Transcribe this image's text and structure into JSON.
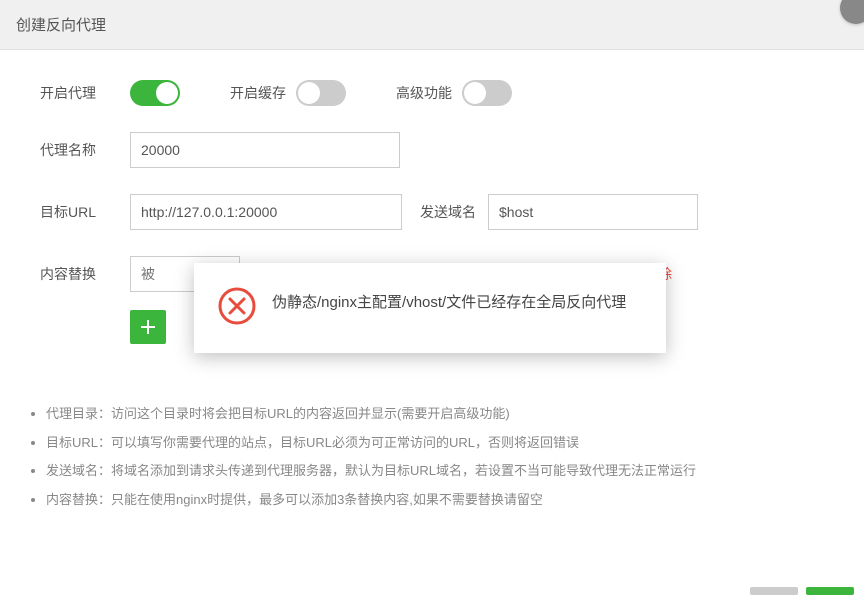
{
  "header": {
    "title": "创建反向代理"
  },
  "form": {
    "proxy_label": "开启代理",
    "cache_label": "开启缓存",
    "advanced_label": "高级功能",
    "name_label": "代理名称",
    "name_value": "20000",
    "url_label": "目标URL",
    "url_value": "http://127.0.0.1:20000",
    "send_domain_label": "发送域名",
    "send_domain_value": "$host",
    "replace_label": "内容替换",
    "replace_from_placeholder": "被",
    "delete_label": "删除"
  },
  "notes": {
    "n1": "代理目录：访问这个目录时将会把目标URL的内容返回并显示(需要开启高级功能)",
    "n2": "目标URL：可以填写你需要代理的站点，目标URL必须为可正常访问的URL，否则将返回错误",
    "n3": "发送域名：将域名添加到请求头传递到代理服务器，默认为目标URL域名，若设置不当可能导致代理无法正常运行",
    "n4": "内容替换：只能在使用nginx时提供，最多可以添加3条替换内容,如果不需要替换请留空"
  },
  "popup": {
    "message": "伪静态/nginx主配置/vhost/文件已经存在全局反向代理"
  }
}
